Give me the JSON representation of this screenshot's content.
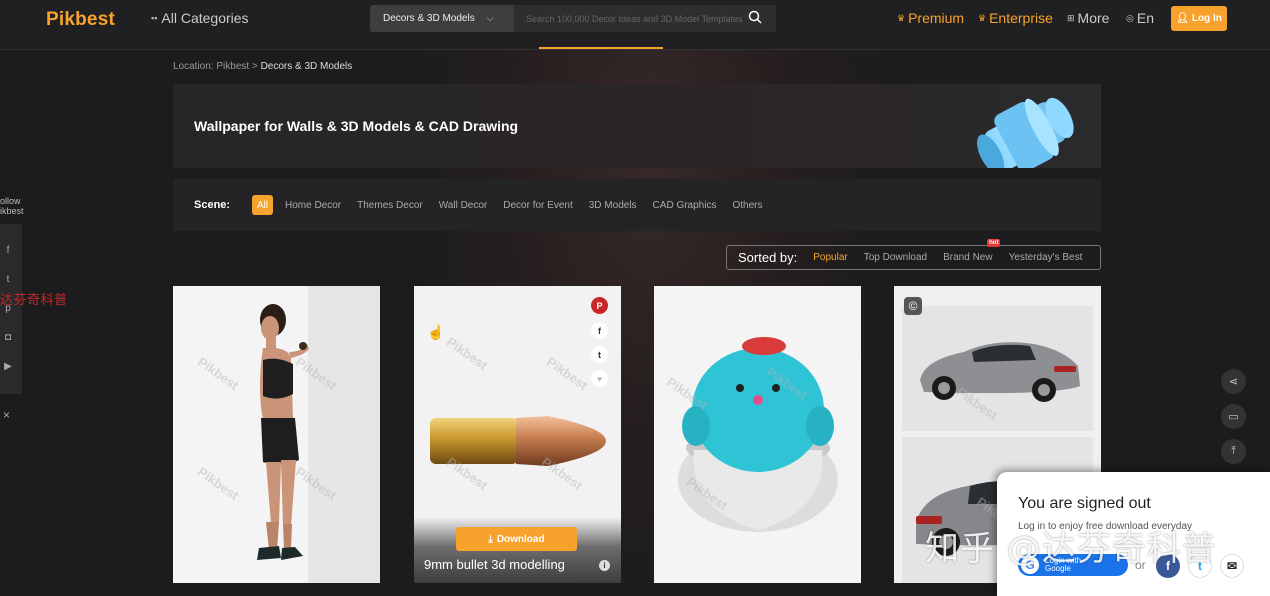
{
  "header": {
    "logo": "Pikbest",
    "all_categories": "All Categories",
    "search_category": "Decors & 3D Models",
    "search_placeholder": "Search 100,000 Decor Ideas and 3D Model Templates",
    "premium": "Premium",
    "enterprise": "Enterprise",
    "more": "More",
    "language": "En",
    "login": "Log In"
  },
  "breadcrumb": {
    "prefix": "Location: Pikbest > ",
    "current": "Decors & 3D Models"
  },
  "banner": {
    "title": "Wallpaper for Walls & 3D Models & CAD Drawing"
  },
  "scene": {
    "label": "Scene:",
    "items": [
      "All",
      "Home Decor",
      "Themes Decor",
      "Wall Decor",
      "Decor for Event",
      "3D Models",
      "CAD Graphics",
      "Others"
    ],
    "active_index": 0
  },
  "sort": {
    "label": "Sorted by:",
    "options": [
      "Popular",
      "Top Download",
      "Brand New",
      "Yesterday's Best"
    ],
    "active_index": 0,
    "hot_badge": "hot"
  },
  "sidebar": {
    "follow_label_1": "ollow",
    "follow_label_2": "ikbest",
    "close": "×"
  },
  "watermark_text": "达芬奇科普",
  "bottom_watermark": "知乎 @达芬奇科普",
  "cards": [
    {
      "watermark": "Pikbest"
    },
    {
      "watermark": "Pikbest",
      "download_label": "Download",
      "title": "9mm bullet 3d modelling"
    },
    {
      "watermark": "Pikbest"
    },
    {
      "watermark": "Pikbest"
    }
  ],
  "popup": {
    "title": "You are signed out",
    "text": "Log in to enjoy free download everyday",
    "google_label_1": "Login with",
    "google_label_2": "Google",
    "or": "or"
  },
  "colors": {
    "accent": "#f7a22c",
    "background": "#1c1c1e",
    "pinterest": "#c62828",
    "facebook": "#3b5998",
    "google_blue": "#1a73e8"
  }
}
